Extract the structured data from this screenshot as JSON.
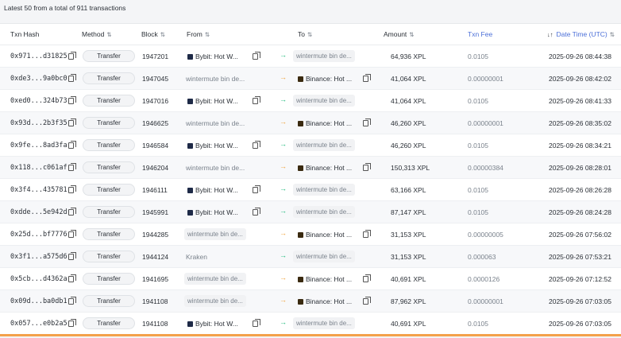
{
  "summary": "Latest 50 from a total of 911 transactions",
  "colors": {
    "in_arrow": "#1db97a",
    "out_arrow": "#f0a23a",
    "accent": "#f3a14b",
    "link": "#4b6fd8"
  },
  "icons": {
    "copy": "copy-icon",
    "filter": "filter-icon",
    "sort": "sort-icon",
    "arrow": "arrow-right-icon"
  },
  "headers": {
    "hash": "Txn Hash",
    "method": "Method",
    "block": "Block",
    "from": "From",
    "to": "To",
    "amount": "Amount",
    "fee": "Txn Fee",
    "datetime": "Date Time (UTC)",
    "filter_glyph": "⇅",
    "sort_glyph": "↓↑"
  },
  "rows": [
    {
      "hash": "0x971...d31825",
      "method": "Transfer",
      "block": "1947201",
      "from": "Bybit: Hot W...",
      "from_type": "bybit",
      "to": "wintermute bin de...",
      "to_type": "plain",
      "dir": "in",
      "amount": "64,936 XPL",
      "fee": "0.0105",
      "time": "2025-09-26 08:44:38"
    },
    {
      "hash": "0xde3...9a0bc0",
      "method": "Transfer",
      "block": "1947045",
      "from": "wintermute bin de...",
      "from_type": "plain",
      "to": "Binance: Hot ...",
      "to_type": "binance",
      "dir": "out",
      "amount": "41,064 XPL",
      "fee": "0.00000001",
      "time": "2025-09-26 08:42:02"
    },
    {
      "hash": "0xed0...324b73",
      "method": "Transfer",
      "block": "1947016",
      "from": "Bybit: Hot W...",
      "from_type": "bybit",
      "to": "wintermute bin de...",
      "to_type": "plain",
      "dir": "in",
      "amount": "41,064 XPL",
      "fee": "0.0105",
      "time": "2025-09-26 08:41:33"
    },
    {
      "hash": "0x93d...2b3f35",
      "method": "Transfer",
      "block": "1946625",
      "from": "wintermute bin de...",
      "from_type": "plain",
      "to": "Binance: Hot ...",
      "to_type": "binance",
      "dir": "out",
      "amount": "46,260 XPL",
      "fee": "0.00000001",
      "time": "2025-09-26 08:35:02"
    },
    {
      "hash": "0x9fe...8ad3fa",
      "method": "Transfer",
      "block": "1946584",
      "from": "Bybit: Hot W...",
      "from_type": "bybit",
      "to": "wintermute bin de...",
      "to_type": "plain",
      "dir": "in",
      "amount": "46,260 XPL",
      "fee": "0.0105",
      "time": "2025-09-26 08:34:21"
    },
    {
      "hash": "0x118...c061af",
      "method": "Transfer",
      "block": "1946204",
      "from": "wintermute bin de...",
      "from_type": "plain",
      "to": "Binance: Hot ...",
      "to_type": "binance",
      "dir": "out",
      "amount": "150,313 XPL",
      "fee": "0.00000384",
      "time": "2025-09-26 08:28:01"
    },
    {
      "hash": "0x3f4...435781",
      "method": "Transfer",
      "block": "1946111",
      "from": "Bybit: Hot W...",
      "from_type": "bybit",
      "to": "wintermute bin de...",
      "to_type": "plain",
      "dir": "in",
      "amount": "63,166 XPL",
      "fee": "0.0105",
      "time": "2025-09-26 08:26:28"
    },
    {
      "hash": "0xdde...5e942d",
      "method": "Transfer",
      "block": "1945991",
      "from": "Bybit: Hot W...",
      "from_type": "bybit",
      "to": "wintermute bin de...",
      "to_type": "plain",
      "dir": "in",
      "amount": "87,147 XPL",
      "fee": "0.0105",
      "time": "2025-09-26 08:24:28"
    },
    {
      "hash": "0x25d...bf7776",
      "method": "Transfer",
      "block": "1944285",
      "from": "wintermute bin de...",
      "from_type": "chip",
      "to": "Binance: Hot ...",
      "to_type": "binance",
      "dir": "out",
      "amount": "31,153 XPL",
      "fee": "0.00000005",
      "time": "2025-09-26 07:56:02"
    },
    {
      "hash": "0x3f1...a575d6",
      "method": "Transfer",
      "block": "1944124",
      "from": "Kraken",
      "from_type": "plain",
      "to": "wintermute bin de...",
      "to_type": "plain",
      "dir": "in",
      "amount": "31,153 XPL",
      "fee": "0.000063",
      "time": "2025-09-26 07:53:21"
    },
    {
      "hash": "0x5cb...d4362a",
      "method": "Transfer",
      "block": "1941695",
      "from": "wintermute bin de...",
      "from_type": "chip",
      "to": "Binance: Hot ...",
      "to_type": "binance",
      "dir": "out",
      "amount": "40,691 XPL",
      "fee": "0.0000126",
      "time": "2025-09-26 07:12:52"
    },
    {
      "hash": "0x09d...ba0db1",
      "method": "Transfer",
      "block": "1941108",
      "from": "wintermute bin de...",
      "from_type": "chip",
      "to": "Binance: Hot ...",
      "to_type": "binance",
      "dir": "out",
      "amount": "87,962 XPL",
      "fee": "0.00000001",
      "time": "2025-09-26 07:03:05"
    },
    {
      "hash": "0x057...e0b2a5",
      "method": "Transfer",
      "block": "1941108",
      "from": "Bybit: Hot W...",
      "from_type": "bybit",
      "to": "wintermute bin de...",
      "to_type": "plain",
      "dir": "in",
      "amount": "40,691 XPL",
      "fee": "0.0105",
      "time": "2025-09-26 07:03:05"
    }
  ]
}
